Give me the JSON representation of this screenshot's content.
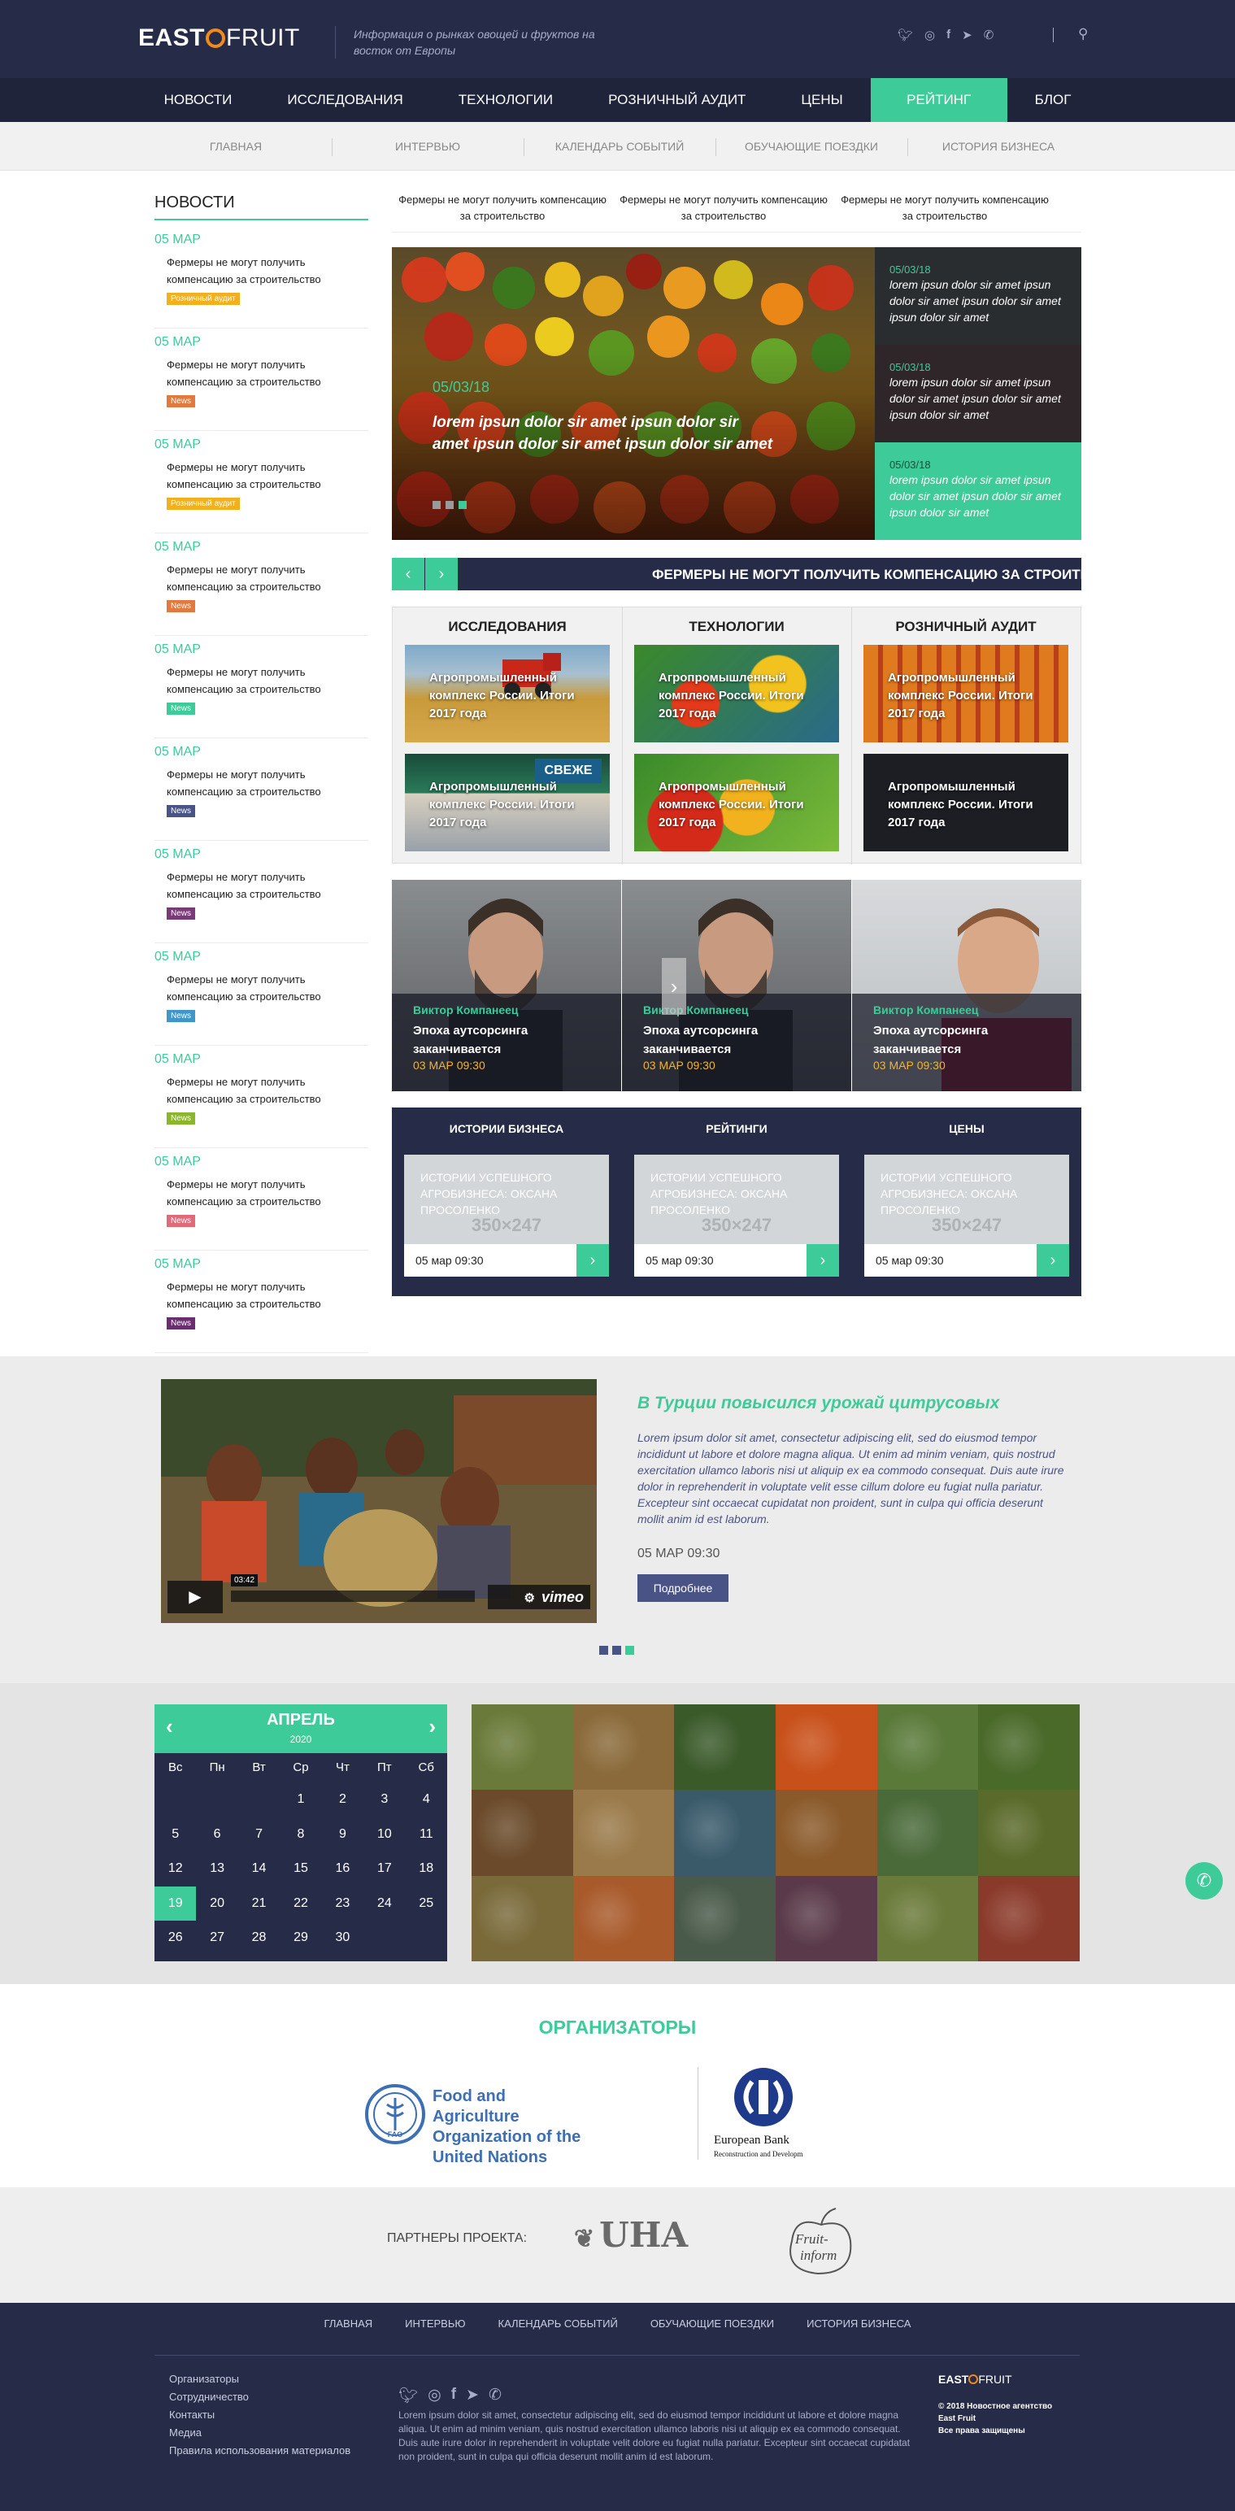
{
  "header": {
    "logo_left": "EAST",
    "logo_right": "FRUIT",
    "tagline": "Информация о рынках овощей и фруктов на восток от Европы",
    "social_icons": [
      "twitter-icon",
      "instagram-icon",
      "facebook-icon",
      "telegram-icon",
      "viber-icon"
    ],
    "search_icon": "search-icon"
  },
  "nav": {
    "items": [
      "НОВОСТИ",
      "ИССЛЕДОВАНИЯ",
      "ТЕХНОЛОГИИ",
      "РОЗНИЧНЫЙ АУДИТ",
      "ЦЕНЫ",
      "РЕЙТИНГ",
      "БЛОГ"
    ],
    "active": "РЕЙТИНГ",
    "active_color": "#3dcb99"
  },
  "subnav": [
    "ГЛАВНАЯ",
    "ИНТЕРВЬЮ",
    "КАЛЕНДАРЬ СОБЫТИЙ",
    "ОБУЧАЮЩИЕ ПОЕЗДКИ",
    "ИСТОРИЯ БИЗНЕСА"
  ],
  "sidebar": {
    "title": "НОВОСТИ",
    "items": [
      {
        "date": "05 МАР",
        "title": "Фермеры не могут получить компенсацию за строительство",
        "badge": "Розничный аудит",
        "color": "#f2b01e"
      },
      {
        "date": "05 МАР",
        "title": "Фермеры не могут получить компенсацию за строительство",
        "badge": "News",
        "color": "#e07a3f"
      },
      {
        "date": "05 МАР",
        "title": "Фермеры не могут получить компенсацию за строительство",
        "badge": "Розничный аудит",
        "color": "#f2b01e"
      },
      {
        "date": "05 МАР",
        "title": "Фермеры не могут получить компенсацию за строительство",
        "badge": "News",
        "color": "#e07a3f"
      },
      {
        "date": "05 МАР",
        "title": "Фермеры не могут получить компенсацию за строительство",
        "badge": "News",
        "color": "#3dcb99"
      },
      {
        "date": "05 МАР",
        "title": "Фермеры не могут получить компенсацию за строительство",
        "badge": "News",
        "color": "#4a5385"
      },
      {
        "date": "05 МАР",
        "title": "Фермеры не могут получить компенсацию за строительство",
        "badge": "News",
        "color": "#7a3a78"
      },
      {
        "date": "05 МАР",
        "title": "Фермеры не могут получить компенсацию за строительство",
        "badge": "News",
        "color": "#3f97c9"
      },
      {
        "date": "05 МАР",
        "title": "Фермеры не могут получить компенсацию за строительство",
        "badge": "News",
        "color": "#8bb52a"
      },
      {
        "date": "05 МАР",
        "title": "Фермеры не могут получить компенсацию за строительство",
        "badge": "News",
        "color": "#e06a7a"
      },
      {
        "date": "05 МАР",
        "title": "Фермеры не могут получить компенсацию за строительство",
        "badge": "News",
        "color": "#6a2e70"
      }
    ]
  },
  "ticker": [
    "Фермеры не могут получить компенсацию за строительство",
    "Фермеры не могут получить компенсацию за строительство",
    "Фермеры не могут получить компенсацию за строительство"
  ],
  "slider": {
    "date": "05/03/18",
    "title": "lorem ipsun dolor sir amet ipsun dolor sir amet ipsun dolor sir amet ipsun dolor sir amet",
    "side": [
      {
        "date": "05/03/18",
        "text": "lorem ipsun dolor sir amet ipsun dolor sir amet ipsun dolor sir amet ipsun dolor sir amet"
      },
      {
        "date": "05/03/18",
        "text": "lorem ipsun dolor sir amet ipsun dolor sir amet ipsun dolor sir amet ipsun dolor sir amet"
      },
      {
        "date": "05/03/18",
        "text": "lorem ipsun dolor sir amet ipsun dolor sir amet ipsun dolor sir amet ipsun dolor sir amet"
      }
    ]
  },
  "marquee": {
    "text": "ФЕРМЕРЫ НЕ МОГУТ ПОЛУЧИТЬ КОМПЕНСАЦИЮ ЗА СТРОИТЕЛЬСТВО",
    "prev": "‹",
    "next": "›"
  },
  "categories": {
    "headers": [
      "ИССЛЕДОВАНИЯ",
      "ТЕХНОЛОГИИ",
      "РОЗНИЧНЫЙ АУДИТ"
    ],
    "tile_text": "Агропромышленный комплекс России. Итоги 2017 года"
  },
  "people": [
    {
      "name": "Виктор Компанеец",
      "title": "Эпоха аутсорсинга заканчивается",
      "date": "03 МАР 09:30"
    },
    {
      "name": "Виктор Компанеец",
      "title": "Эпоха аутсорсинга заканчивается",
      "date": "03 МАР 09:30"
    },
    {
      "name": "Виктор Компанеец",
      "title": "Эпоха аутсорсинга заканчивается",
      "date": "03 МАР 09:30"
    }
  ],
  "business": {
    "headers": [
      "ИСТОРИИ БИЗНЕСА",
      "РЕЙТИНГИ",
      "ЦЕНЫ"
    ],
    "card_text": "ИСТОРИИ УСПЕШНОГО АГРОБИЗНЕСА: ОКСАНА ПРОСОЛЕНКО",
    "placeholder": "350×247",
    "date": "05 мар 09:30",
    "arrow": "›"
  },
  "featured": {
    "title": "В Турции повысился урожай цитрусовых",
    "text": "Lorem ipsum dolor sit amet, consectetur adipiscing elit, sed do eiusmod tempor incididunt ut labore et dolore magna aliqua. Ut enim ad minim veniam, quis nostrud exercitation ullamco laboris nisi ut aliquip ex ea commodo consequat. Duis aute irure dolor in reprehenderit in voluptate velit esse cillum dolore eu fugiat nulla pariatur. Excepteur sint occaecat cupidatat non proident, sunt in culpa qui officia deserunt mollit anim id est laborum.",
    "date": "05 МАР 09:30",
    "button": "Подробнее",
    "video_time": "03:42",
    "video_brand": "vimeo"
  },
  "calendar": {
    "month": "АПРЕЛЬ",
    "year": "2020",
    "weekdays": [
      "Вс",
      "Пн",
      "Вт",
      "Ср",
      "Чт",
      "Пт",
      "Сб"
    ],
    "days": [
      "",
      "",
      "",
      "1",
      "2",
      "3",
      "4",
      "5",
      "6",
      "7",
      "8",
      "9",
      "10",
      "11",
      "12",
      "13",
      "14",
      "15",
      "16",
      "17",
      "18",
      "19",
      "20",
      "21",
      "22",
      "23",
      "24",
      "25",
      "26",
      "27",
      "28",
      "29",
      "30",
      "",
      ""
    ],
    "today": "19"
  },
  "organizers": {
    "title": "ОРГАНИЗАТОРЫ",
    "fao": "Food and Agriculture Organization of the United Nations",
    "fao_mark": "FAO",
    "ebrd_1": "European Bank",
    "ebrd_2": "Reconstruction and Developm"
  },
  "partners": {
    "label": "ПАРТНЕРЫ ПРОЕКТА:",
    "uha": "UHA",
    "fruit_inform_1": "Fruit-",
    "fruit_inform_2": "inform"
  },
  "footer": {
    "nav": [
      "ГЛАВНАЯ",
      "ИНТЕРВЬЮ",
      "КАЛЕНДАРЬ СОБЫТИЙ",
      "ОБУЧАЮЩИЕ ПОЕЗДКИ",
      "ИСТОРИЯ БИЗНЕСА"
    ],
    "links": [
      "Организаторы",
      "Сотрудничество",
      "Контакты",
      "Медиа",
      "Правила использования материалов"
    ],
    "text": "Lorem ipsum dolor sit amet, consectetur adipiscing elit, sed do eiusmod tempor incididunt ut labore et dolore magna aliqua. Ut enim ad minim veniam, quis nostrud exercitation ullamco laboris nisi ut aliquip ex ea commodo consequat. Duis aute irure dolor in reprehenderit in voluptate velit dolore eu fugiat nulla pariatur. Excepteur sint occaecat cupidatat non proident, sunt in culpa qui officia deserunt mollit anim id est laborum.",
    "copy_1": "© 2018 Новостное агентство",
    "copy_2": "East Fruit",
    "copy_3": "Все права защищены",
    "logo_left": "EAST",
    "logo_right": "FRUIT"
  }
}
